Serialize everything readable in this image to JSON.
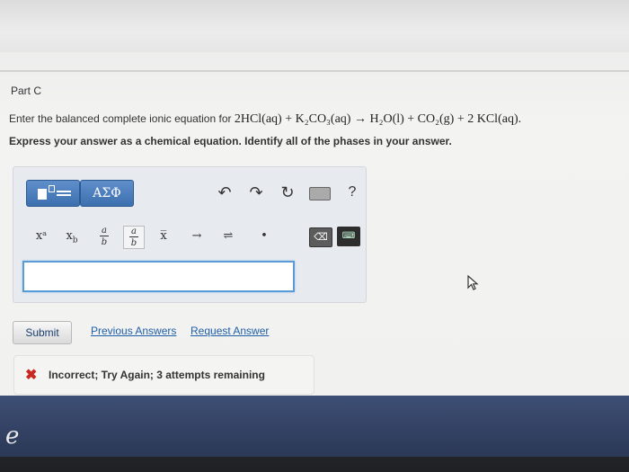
{
  "part": {
    "title": "Part C"
  },
  "question": {
    "prompt": "Enter the balanced complete ionic equation for",
    "equation": "2HCl(aq) + K₂CO₃(aq) → H₂O(l) + CO₂(g) + 2 KCl(aq).",
    "instruction": "Express your answer as a chemical equation. Identify all of the phases in your answer."
  },
  "toolbar": {
    "greek_label": "ΑΣΦ",
    "undo_icon": "undo-icon",
    "redo_icon": "redo-icon",
    "reset_icon": "reset-icon",
    "keyboard_icon": "keyboard-icon",
    "help_label": "?",
    "superscript": "xᵃ",
    "subscript": "x_b",
    "fraction_top": "a",
    "fraction_bottom": "b",
    "vector_label": "x̅",
    "arrow_label": "→",
    "equilibrium_label": "⇌",
    "dot_label": "•"
  },
  "answer": {
    "value": ""
  },
  "actions": {
    "submit_label": "Submit",
    "previous_answers_label": "Previous Answers",
    "request_answer_label": "Request Answer"
  },
  "feedback": {
    "icon": "x-icon",
    "text": "Incorrect; Try Again; 3 attempts remaining",
    "color": "#c8281f"
  },
  "accent_color": "#3d6fae"
}
